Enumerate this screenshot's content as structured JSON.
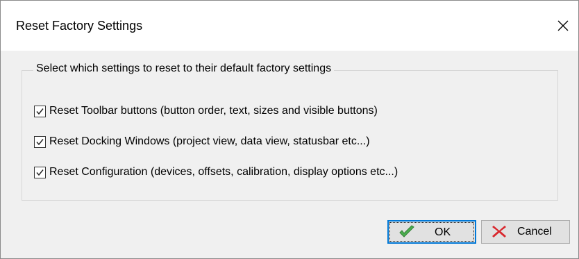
{
  "window": {
    "title": "Reset Factory Settings",
    "close_icon": "close-icon"
  },
  "group": {
    "legend": "Select which settings to reset to their default factory settings",
    "options": [
      {
        "label": "Reset Toolbar buttons (button order, text, sizes and visible buttons)",
        "checked": true
      },
      {
        "label": "Reset Docking Windows (project view, data view, statusbar  etc...)",
        "checked": true
      },
      {
        "label": "Reset Configuration (devices, offsets, calibration, display options etc...)",
        "checked": true
      }
    ]
  },
  "buttons": {
    "ok": {
      "label": "OK",
      "icon": "checkmark-icon",
      "icon_color": "#3fae3f",
      "default": true
    },
    "cancel": {
      "label": "Cancel",
      "icon": "red-x-icon",
      "icon_color": "#d9262c"
    }
  },
  "colors": {
    "focus_border": "#0078d7",
    "dialog_background": "#f0f0f0",
    "titlebar_background": "#ffffff"
  }
}
